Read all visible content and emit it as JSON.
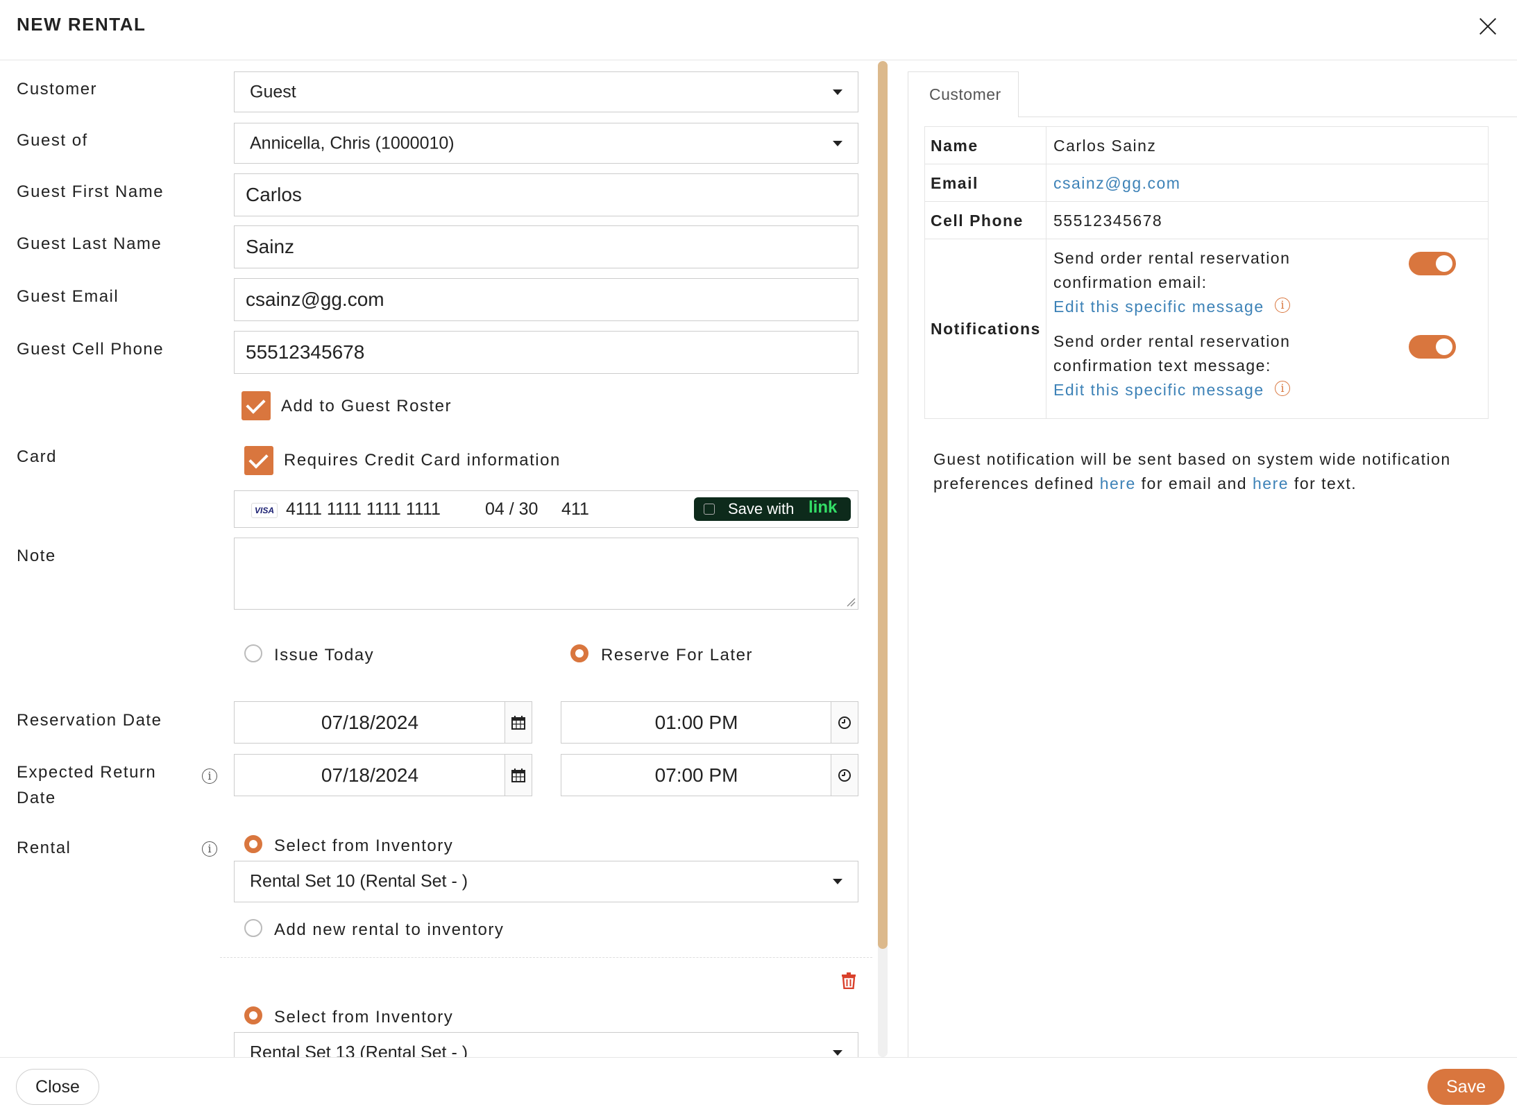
{
  "dialog": {
    "title": "NEW RENTAL"
  },
  "form": {
    "customer": {
      "label": "Customer",
      "value": "Guest"
    },
    "guest_of": {
      "label": "Guest of",
      "value": "Annicella, Chris (1000010)"
    },
    "first_name": {
      "label": "Guest First Name",
      "value": "Carlos"
    },
    "last_name": {
      "label": "Guest Last Name",
      "value": "Sainz"
    },
    "email": {
      "label": "Guest Email",
      "value": "csainz@gg.com"
    },
    "cell_phone": {
      "label": "Guest Cell Phone",
      "value": "55512345678"
    },
    "add_to_roster": {
      "label": "Add to Guest Roster",
      "checked": true
    },
    "card": {
      "label": "Card",
      "requires_label": "Requires Credit Card information",
      "requires_checked": true,
      "brand": "VISA",
      "number": "4111 1111 1111 1111",
      "expiry": "04 / 30",
      "cvc": "411",
      "save_with": "Save with",
      "link_brand": "link"
    },
    "note": {
      "label": "Note",
      "value": ""
    },
    "issue_today": {
      "label": "Issue Today",
      "selected": false
    },
    "reserve_later": {
      "label": "Reserve For Later",
      "selected": true
    },
    "reservation": {
      "label": "Reservation Date",
      "date": "07/18/2024",
      "time": "01:00 PM"
    },
    "expected_return": {
      "label_line1": "Expected Return",
      "label_line2": "Date",
      "date": "07/18/2024",
      "time": "07:00 PM"
    },
    "rental": {
      "label": "Rental",
      "items": [
        {
          "select_label": "Select from Inventory",
          "value": "Rental Set 10 (Rental Set - )",
          "add_new_label": "Add new rental to inventory"
        },
        {
          "select_label": "Select from Inventory",
          "value": "Rental Set 13 (Rental Set - )"
        }
      ]
    }
  },
  "side": {
    "tab": "Customer",
    "rows": {
      "name": {
        "label": "Name",
        "value": "Carlos Sainz"
      },
      "email": {
        "label": "Email",
        "value": "csainz@gg.com"
      },
      "phone": {
        "label": "Cell Phone",
        "value": "55512345678"
      },
      "notifications": {
        "label": "Notifications",
        "email_line1": "Send order rental reservation",
        "email_line2": "confirmation email:",
        "text_line1": "Send order rental reservation",
        "text_line2": "confirmation text message:",
        "edit_link": "Edit this specific message",
        "email_on": true,
        "text_on": true
      }
    },
    "note_line1": "Guest notification will be sent based on system wide notification",
    "note_line2_a": "preferences defined ",
    "note_here1": "here",
    "note_line2_b": " for email and ",
    "note_here2": "here",
    "note_line2_c": " for text."
  },
  "footer": {
    "close": "Close",
    "save": "Save"
  },
  "colors": {
    "accent": "#d9763e",
    "link": "#3d82b7",
    "scrollbar": "#dcb98c"
  }
}
